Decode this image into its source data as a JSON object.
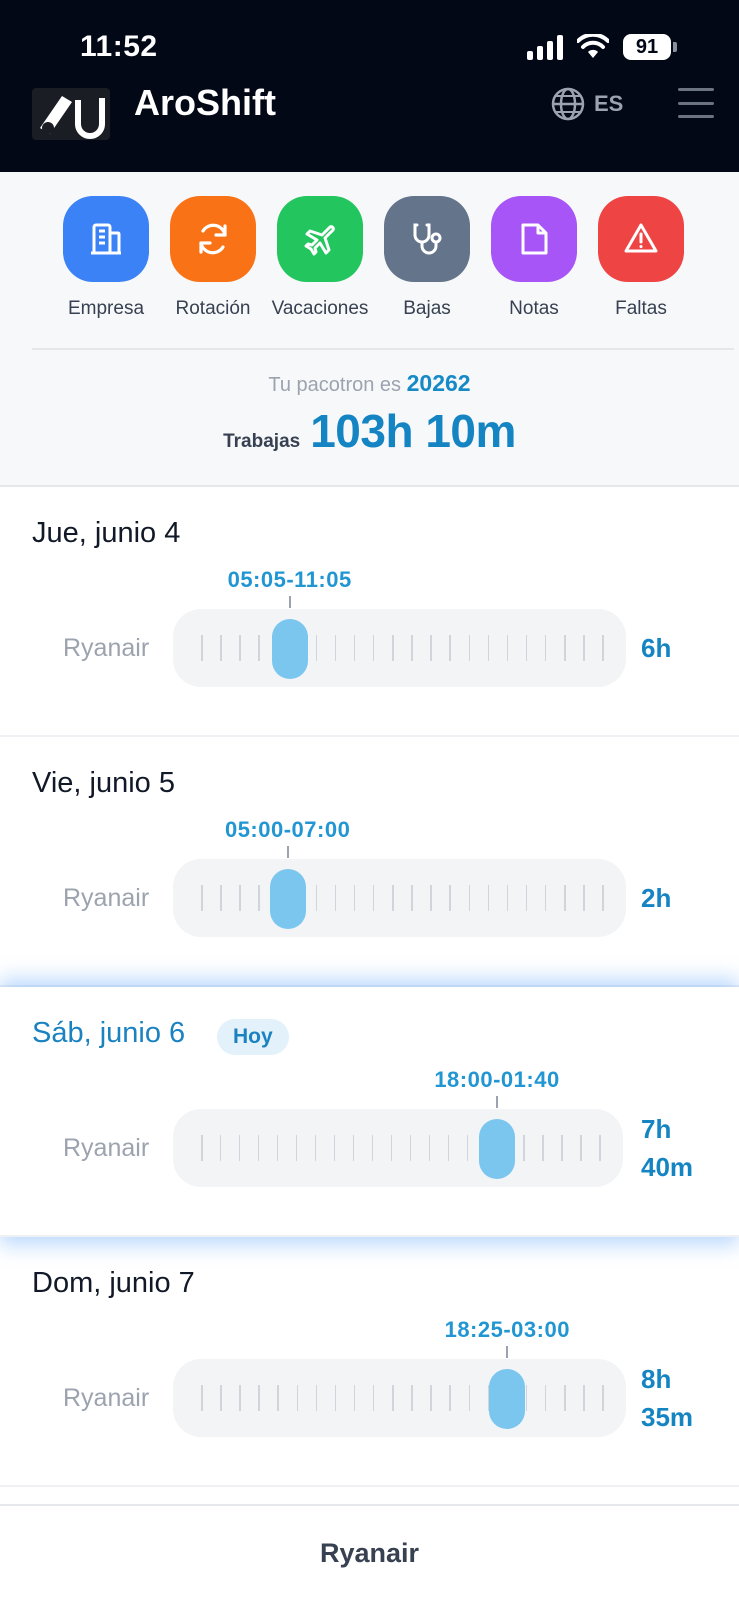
{
  "status": {
    "time": "11:52",
    "battery": "91"
  },
  "header": {
    "title": "AroShift",
    "lang": "ES"
  },
  "actions": [
    {
      "label": "Empresa",
      "color": "#3b82f6",
      "icon": "building-icon"
    },
    {
      "label": "Rotación",
      "color": "#f97316",
      "icon": "rotate-icon"
    },
    {
      "label": "Vacaciones",
      "color": "#22c55e",
      "icon": "plane-icon"
    },
    {
      "label": "Bajas",
      "color": "#64748b",
      "icon": "stethoscope-icon"
    },
    {
      "label": "Notas",
      "color": "#a855f7",
      "icon": "note-icon"
    },
    {
      "label": "Faltas",
      "color": "#ef4444",
      "icon": "warning-icon"
    }
  ],
  "summary": {
    "pacotron_label": "Tu pacotron es",
    "pacotron_value": "20262",
    "worked_label": "Trabajas",
    "worked_value": "103h 10m"
  },
  "days": [
    {
      "title": "Jue, junio 4",
      "badge": "",
      "today": false,
      "shift": "05:05-11:05",
      "airline": "Ryanair",
      "hours": [
        "6h"
      ],
      "position": 0.22
    },
    {
      "title": "Vie, junio 5",
      "badge": "",
      "today": false,
      "shift": "05:00-07:00",
      "airline": "Ryanair",
      "hours": [
        "2h"
      ],
      "position": 0.215
    },
    {
      "title": "Sáb, junio 6",
      "badge": "Hoy",
      "today": true,
      "shift": "18:00-01:40",
      "airline": "Ryanair",
      "hours": [
        "7h",
        "40m"
      ],
      "position": 0.74
    },
    {
      "title": "Dom, junio 7",
      "badge": "",
      "today": false,
      "shift": "18:25-03:00",
      "airline": "Ryanair",
      "hours": [
        "8h",
        "35m"
      ],
      "position": 0.76
    }
  ],
  "bottom": {
    "label": "Ryanair"
  }
}
